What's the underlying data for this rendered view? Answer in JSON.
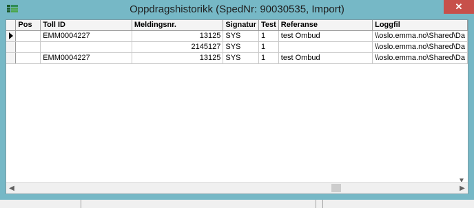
{
  "window": {
    "title": "Oppdragshistorikk (SpedNr: 90030535, Import)",
    "close_label": "✕"
  },
  "grid": {
    "columns": [
      "Pos",
      "Toll ID",
      "Meldingsnr.",
      "Signatur",
      "Test",
      "Referanse",
      "Loggfil"
    ],
    "rows": [
      {
        "pos": "",
        "toll_id": "EMM0004227",
        "meldingsnr": "13125",
        "signatur": "SYS",
        "test": "1",
        "referanse": "test Ombud",
        "loggfil": "\\\\oslo.emma.no\\Shared\\Da"
      },
      {
        "pos": "",
        "toll_id": "",
        "meldingsnr": "2145127",
        "signatur": "SYS",
        "test": "1",
        "referanse": "",
        "loggfil": "\\\\oslo.emma.no\\Shared\\Da"
      },
      {
        "pos": "",
        "toll_id": "EMM0004227",
        "meldingsnr": "13125",
        "signatur": "SYS",
        "test": "1",
        "referanse": "test Ombud",
        "loggfil": "\\\\oslo.emma.no\\Shared\\Da"
      }
    ],
    "current_row": 0
  },
  "scroll": {
    "left_icon": "chevron-left-icon",
    "right_icon": "chevron-right-icon",
    "down_icon": "chevron-down-icon"
  },
  "colors": {
    "titlebar": "#76b8c6",
    "close": "#c7504a"
  }
}
